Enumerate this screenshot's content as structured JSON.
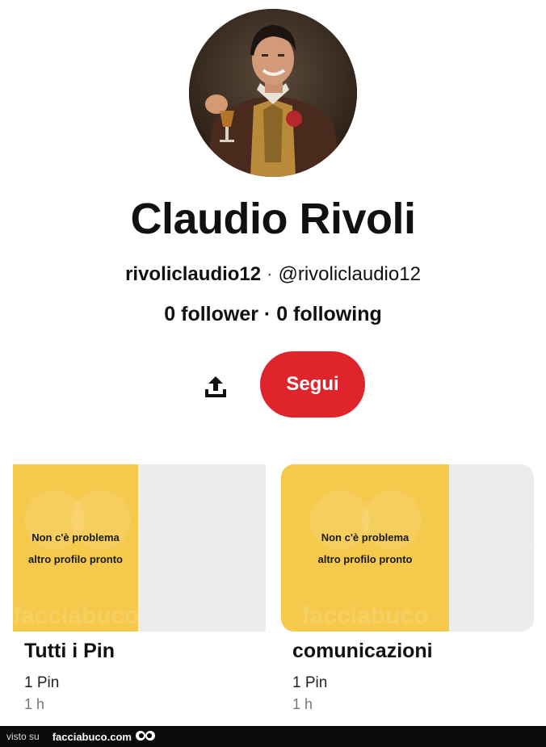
{
  "profile": {
    "name": "Claudio Rivoli",
    "username": "rivoliclaudio12",
    "separator": "·",
    "handle": "@rivoliclaudio12",
    "followers": "0 follower",
    "following": "0 following"
  },
  "actions": {
    "share_icon": "share-upload-icon",
    "follow_label": "Segui",
    "follow_color": "#e0242b"
  },
  "boards": [
    {
      "title": "Tutti i Pin",
      "count": "1 Pin",
      "time": "1 h",
      "pin_text_line1": "Non c'è problema",
      "pin_text_line2": "altro profilo pronto",
      "watermark": "facciabuco"
    },
    {
      "title": "comunicazioni",
      "count": "1 Pin",
      "time": "1 h",
      "pin_text_line1": "Non c'è problema",
      "pin_text_line2": "altro profilo pronto",
      "watermark": "facciabuco"
    }
  ],
  "footer": {
    "visto": "visto su",
    "brand": "facciabuco.com"
  },
  "colors": {
    "pin_yellow": "#f4c94c",
    "placeholder_grey": "#ececec"
  }
}
